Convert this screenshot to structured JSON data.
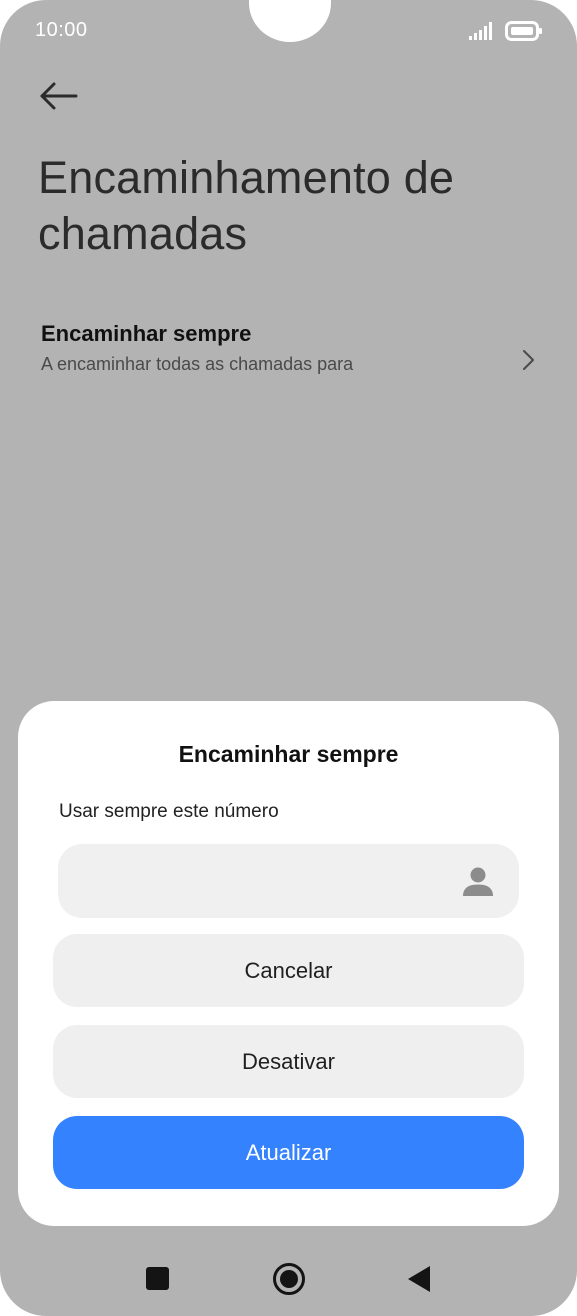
{
  "status_bar": {
    "time": "10:00",
    "signal_icon": "signal-icon",
    "battery_icon": "battery-icon"
  },
  "header": {
    "back_icon": "arrow-left-icon",
    "title": "Encaminhamento de chamadas"
  },
  "settings_item": {
    "title": "Encaminhar sempre",
    "subtitle": "A encaminhar todas as chamadas para",
    "chevron_icon": "chevron-right-icon"
  },
  "dialog": {
    "title": "Encaminhar sempre",
    "label": "Usar sempre este número",
    "input": {
      "value": "",
      "placeholder": ""
    },
    "contact_icon": "person-icon",
    "cancel_label": "Cancelar",
    "disable_label": "Desativar",
    "update_label": "Atualizar"
  },
  "nav_bar": {
    "recents_icon": "square-icon",
    "home_icon": "circle-icon",
    "back_icon": "triangle-left-icon"
  },
  "colors": {
    "background_dim": "#b3b3b3",
    "accent": "#3582ff",
    "button_grey": "#efefef"
  }
}
